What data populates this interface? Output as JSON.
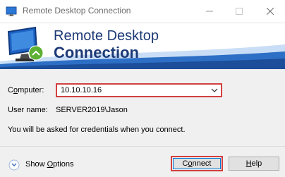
{
  "window": {
    "title": "Remote Desktop Connection",
    "controls": [
      "minimize",
      "maximize",
      "close"
    ]
  },
  "banner": {
    "line1": "Remote Desktop",
    "line2": "Connection",
    "logo_icon": "rdc-monitor-icon"
  },
  "form": {
    "computer_label": "Computer:",
    "computer_value": "10.10.10.16",
    "username_label": "User name:",
    "username_value": "SERVER2019\\Jason",
    "credentials_note": "You will be asked for credentials when you connect."
  },
  "footer": {
    "show_options_label": "Show Options",
    "connect_label": "Connect",
    "help_label": "Help"
  },
  "colors": {
    "banner_text": "#1d3a77",
    "highlight": "#d24040",
    "focus_blue": "#0078d7"
  }
}
